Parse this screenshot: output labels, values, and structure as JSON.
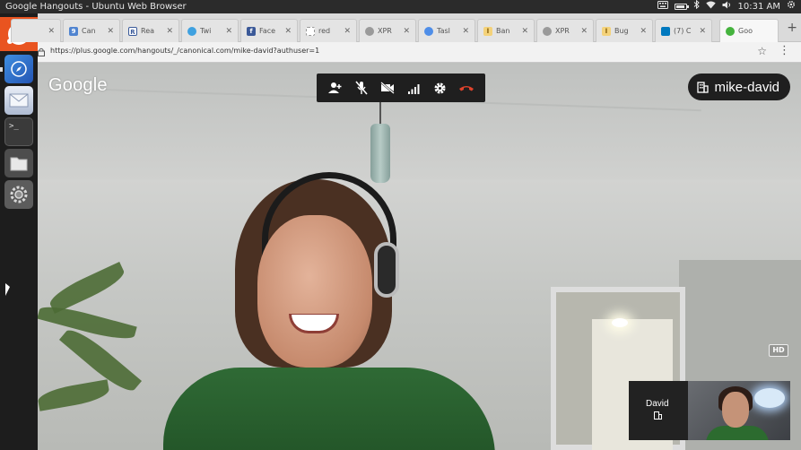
{
  "panel": {
    "window_title": "Google Hangouts - Ubuntu Web Browser",
    "clock": "10:31 AM"
  },
  "launcher": {
    "items": [
      {
        "name": "ubuntu-dash"
      },
      {
        "name": "web-browser"
      },
      {
        "name": "mail"
      },
      {
        "name": "terminal",
        "label": ">_"
      },
      {
        "name": "files"
      },
      {
        "name": "system-settings"
      }
    ]
  },
  "tabs": [
    {
      "label": "Can",
      "favicon_letter": "9",
      "color": "#5084d0"
    },
    {
      "label": "Rea",
      "favicon_letter": "R",
      "color": "#3a5a9a"
    },
    {
      "label": "Twi",
      "favicon_letter": "",
      "color": "#3fa1e0"
    },
    {
      "label": "Face",
      "favicon_letter": "f",
      "color": "#3b5998"
    },
    {
      "label": "red",
      "favicon_letter": "",
      "color": "#cccccc"
    },
    {
      "label": "XPR",
      "favicon_letter": "",
      "color": "#888888"
    },
    {
      "label": "Tasl",
      "favicon_letter": "",
      "color": "#4f8ee8"
    },
    {
      "label": "Ban",
      "favicon_letter": "l",
      "color": "#e8b13c"
    },
    {
      "label": "XPR",
      "favicon_letter": "",
      "color": "#888888"
    },
    {
      "label": "Bug",
      "favicon_letter": "l",
      "color": "#e8b13c"
    },
    {
      "label": "(7) C",
      "favicon_letter": "",
      "color": "#0079bf"
    },
    {
      "label": "Goo",
      "favicon_letter": "",
      "color": "#45b33e",
      "active": true
    }
  ],
  "address": {
    "url": "https://plus.google.com/hangouts/_/canonical.com/mike-david?authuser=1"
  },
  "hangout": {
    "brand": "Google",
    "room_name": "mike-david",
    "quality_badge": "HD",
    "participant_thumbnail_name": "David",
    "toolbar": [
      {
        "name": "invite-people-button",
        "icon": "add-person-icon"
      },
      {
        "name": "mute-mic-button",
        "icon": "mic-off-icon"
      },
      {
        "name": "turn-off-camera-button",
        "icon": "camera-off-icon"
      },
      {
        "name": "bandwidth-button",
        "icon": "signal-bars-icon"
      },
      {
        "name": "settings-button",
        "icon": "gear-icon"
      },
      {
        "name": "end-call-button",
        "icon": "hang-up-icon",
        "color": "#e0432c"
      }
    ]
  }
}
